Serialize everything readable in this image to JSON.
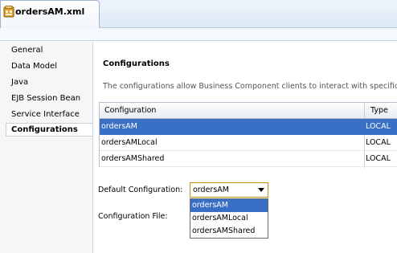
{
  "editor_tab": {
    "label": "ordersAM.xml",
    "icon": "application-module-icon"
  },
  "nav": {
    "items": [
      {
        "label": "General"
      },
      {
        "label": "Data Model"
      },
      {
        "label": "Java"
      },
      {
        "label": "EJB Session Bean"
      },
      {
        "label": "Service Interface"
      },
      {
        "label": "Configurations",
        "active": true
      }
    ]
  },
  "section": {
    "title": "Configurations",
    "description": "The configurations allow Business Component clients to interact with specific,"
  },
  "table": {
    "columns": [
      "Configuration",
      "Type"
    ],
    "rows": [
      {
        "name": "ordersAM",
        "type": "LOCAL",
        "selected": true
      },
      {
        "name": "ordersAMLocal",
        "type": "LOCAL"
      },
      {
        "name": "ordersAMShared",
        "type": "LOCAL"
      }
    ]
  },
  "form": {
    "default_config_label": "Default Configuration:",
    "default_config_value": "ordersAM",
    "config_file_label": "Configuration File:",
    "dropdown_options": [
      "ordersAM",
      "ordersAMLocal",
      "ordersAMShared"
    ],
    "dropdown_selected": "ordersAM"
  },
  "colors": {
    "selection": "#3a6fc6",
    "combo_border": "#c98d16"
  }
}
